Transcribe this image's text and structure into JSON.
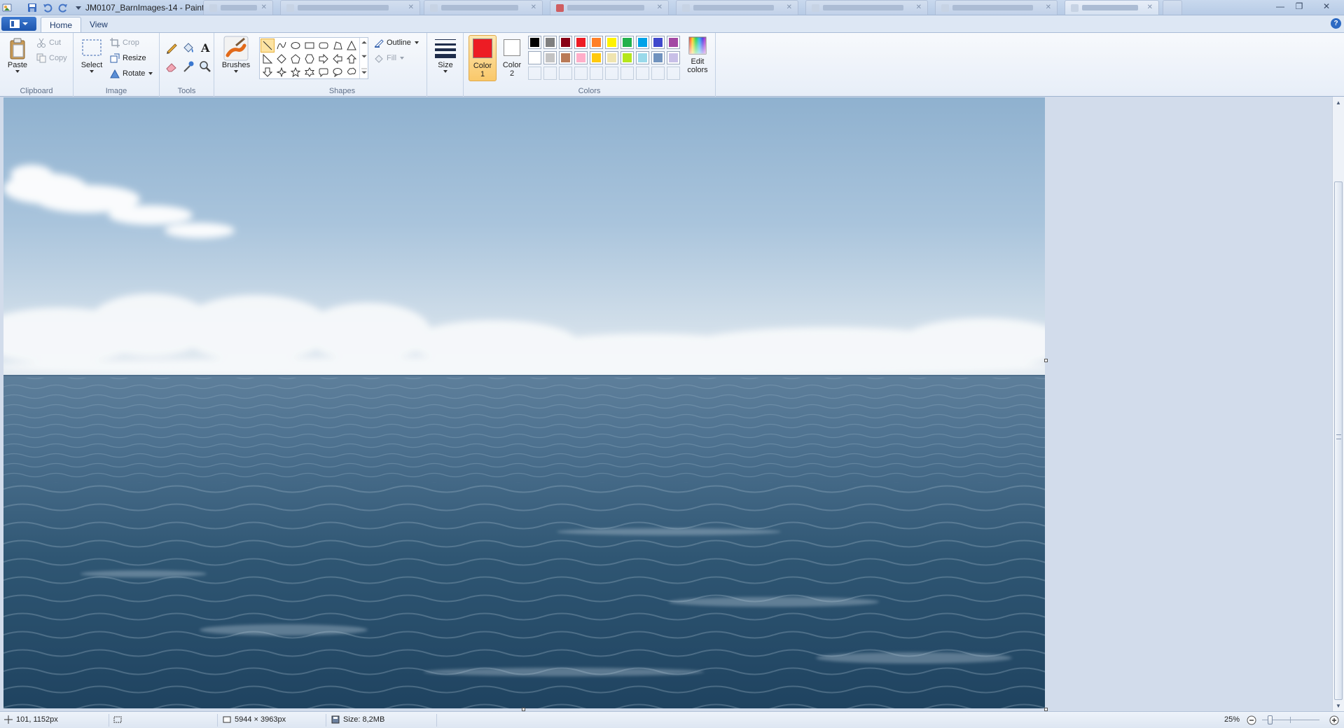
{
  "window": {
    "title": "JM0107_BarnImages-14 - Paint",
    "controls": [
      "minimize-icon",
      "restore-icon",
      "close-icon"
    ]
  },
  "quick_access": [
    "paint-app-icon",
    "save-icon",
    "undo-icon",
    "redo-icon",
    "customize-dropdown-icon"
  ],
  "ribbon_tabs": {
    "home": "Home",
    "view": "View"
  },
  "ribbon": {
    "clipboard": {
      "paste": "Paste",
      "cut": "Cut",
      "copy": "Copy",
      "group": "Clipboard"
    },
    "image": {
      "select": "Select",
      "crop": "Crop",
      "resize": "Resize",
      "rotate": "Rotate",
      "group": "Image"
    },
    "tools": {
      "group": "Tools",
      "items": [
        "pencil-icon",
        "fill-icon",
        "text-icon",
        "eraser-icon",
        "color-picker-icon",
        "magnifier-icon"
      ]
    },
    "brushes": {
      "label": "Brushes"
    },
    "shapes": {
      "outline": "Outline",
      "fill": "Fill",
      "group": "Shapes"
    },
    "size": {
      "label": "Size"
    },
    "colors": {
      "color1": {
        "line1": "Color",
        "line2": "1",
        "value": "#ed1c24"
      },
      "color2": {
        "line1": "Color",
        "line2": "2",
        "value": "#ffffff"
      },
      "edit": {
        "line1": "Edit",
        "line2": "colors"
      },
      "group": "Colors",
      "palette_row1": [
        "#000000",
        "#7f7f7f",
        "#880015",
        "#ed1c24",
        "#ff7f27",
        "#fff200",
        "#22b14c",
        "#00a2e8",
        "#3f48cc",
        "#a349a4"
      ],
      "palette_row2": [
        "#ffffff",
        "#c3c3c3",
        "#b97a57",
        "#ffaec9",
        "#ffc90e",
        "#efe4b0",
        "#b5e61d",
        "#99d9ea",
        "#7092be",
        "#c8bfe7"
      ]
    }
  },
  "status": {
    "cursor": "101, 1152px",
    "dimensions": "5944 × 3963px",
    "size": "Size: 8,2MB",
    "zoom": "25%"
  }
}
